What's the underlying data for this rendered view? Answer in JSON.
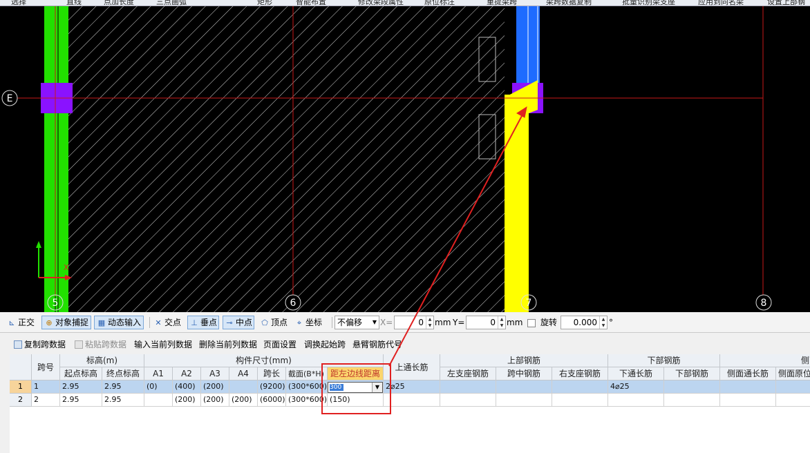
{
  "top_toolbar": {
    "items": [
      "选择",
      "直线",
      "点加长度",
      "三点画弧",
      "矩形",
      "智能布置",
      "修改梁段属性",
      "原位标注",
      "重提梁跨",
      "梁跨数据复制",
      "批量识别梁支座",
      "应用到同名梁",
      "设置上部钢"
    ]
  },
  "canvas": {
    "axis_labels": {
      "E": "E",
      "five": "5",
      "six": "6",
      "seven": "7",
      "eight": "8"
    },
    "coord_labels": {
      "x": "X"
    },
    "colors": {
      "background": "#000000",
      "green_column": "#22e000",
      "purple_support": "#8a12ff",
      "yellow_beam": "#ffff00",
      "blue_column": "#1e6bff",
      "axis_line": "#c81818",
      "hatch": "#d8d8d8"
    }
  },
  "snap_toolbar": {
    "ortho": "正交",
    "object_snap": "对象捕捉",
    "dynamic_input": "动态输入",
    "intersection": "交点",
    "perpendicular": "垂点",
    "midpoint": "中点",
    "vertex": "顶点",
    "coordinate": "坐标",
    "offset_mode": "不偏移",
    "x_label": "X=",
    "x_value": "0",
    "x_unit": "mm",
    "y_label": "Y=",
    "y_value": "0",
    "y_unit": "mm",
    "rotate_label": "旋转",
    "rotate_value": "0.000",
    "rotate_unit": "°"
  },
  "grid_toolbar": {
    "copy_span": "复制跨数据",
    "paste_span": "粘贴跨数据",
    "input_column": "输入当前列数据",
    "delete_column": "删除当前列数据",
    "page_setup": "页面设置",
    "adjust_start_span": "调换起始跨",
    "cantilever_code": "悬臂钢筋代号"
  },
  "table": {
    "headers": {
      "span_no": "跨号",
      "elevation": "标高(m)",
      "start_elev": "起点标高",
      "end_elev": "终点标高",
      "dimensions": "构件尺寸(mm)",
      "a1": "A1",
      "a2": "A2",
      "a3": "A3",
      "a4": "A4",
      "span_len": "跨长",
      "section": "截面(B*H)",
      "dist_left": "距左边线距离",
      "top_through": "上通长筋",
      "top_rebar": "上部钢筋",
      "left_support": "左支座钢筋",
      "mid_span": "跨中钢筋",
      "right_support": "右支座钢筋",
      "bottom_rebar": "下部钢筋",
      "bottom_through": "下通长筋",
      "bottom_rebar_col": "下部钢筋",
      "side_group": "侧面钢",
      "side_through": "侧面通长筋",
      "side_orig": "侧面原位"
    },
    "rows": [
      {
        "row_no": "1",
        "span": "1",
        "start": "2.95",
        "end": "2.95",
        "a1": "(0)",
        "a2": "(400)",
        "a3": "(200)",
        "a4": "",
        "len": "(9200)",
        "section": "(300*600)",
        "dist": "300",
        "top_through": "2⌀25",
        "left_support": "",
        "mid": "",
        "right_support": "",
        "bottom_through": "4⌀25",
        "bottom": "",
        "side_through": "",
        "side_orig": ""
      },
      {
        "row_no": "2",
        "span": "2",
        "start": "2.95",
        "end": "2.95",
        "a1": "",
        "a2": "(200)",
        "a3": "(200)",
        "a4": "(200)",
        "len": "(6000)",
        "section": "(300*600)",
        "dist": "(150)",
        "top_through": "",
        "left_support": "",
        "mid": "",
        "right_support": "",
        "bottom_through": "",
        "bottom": "",
        "side_through": "",
        "side_orig": ""
      }
    ]
  },
  "annotation": {
    "box_color": "#e02020",
    "arrow_color": "#e02020"
  }
}
